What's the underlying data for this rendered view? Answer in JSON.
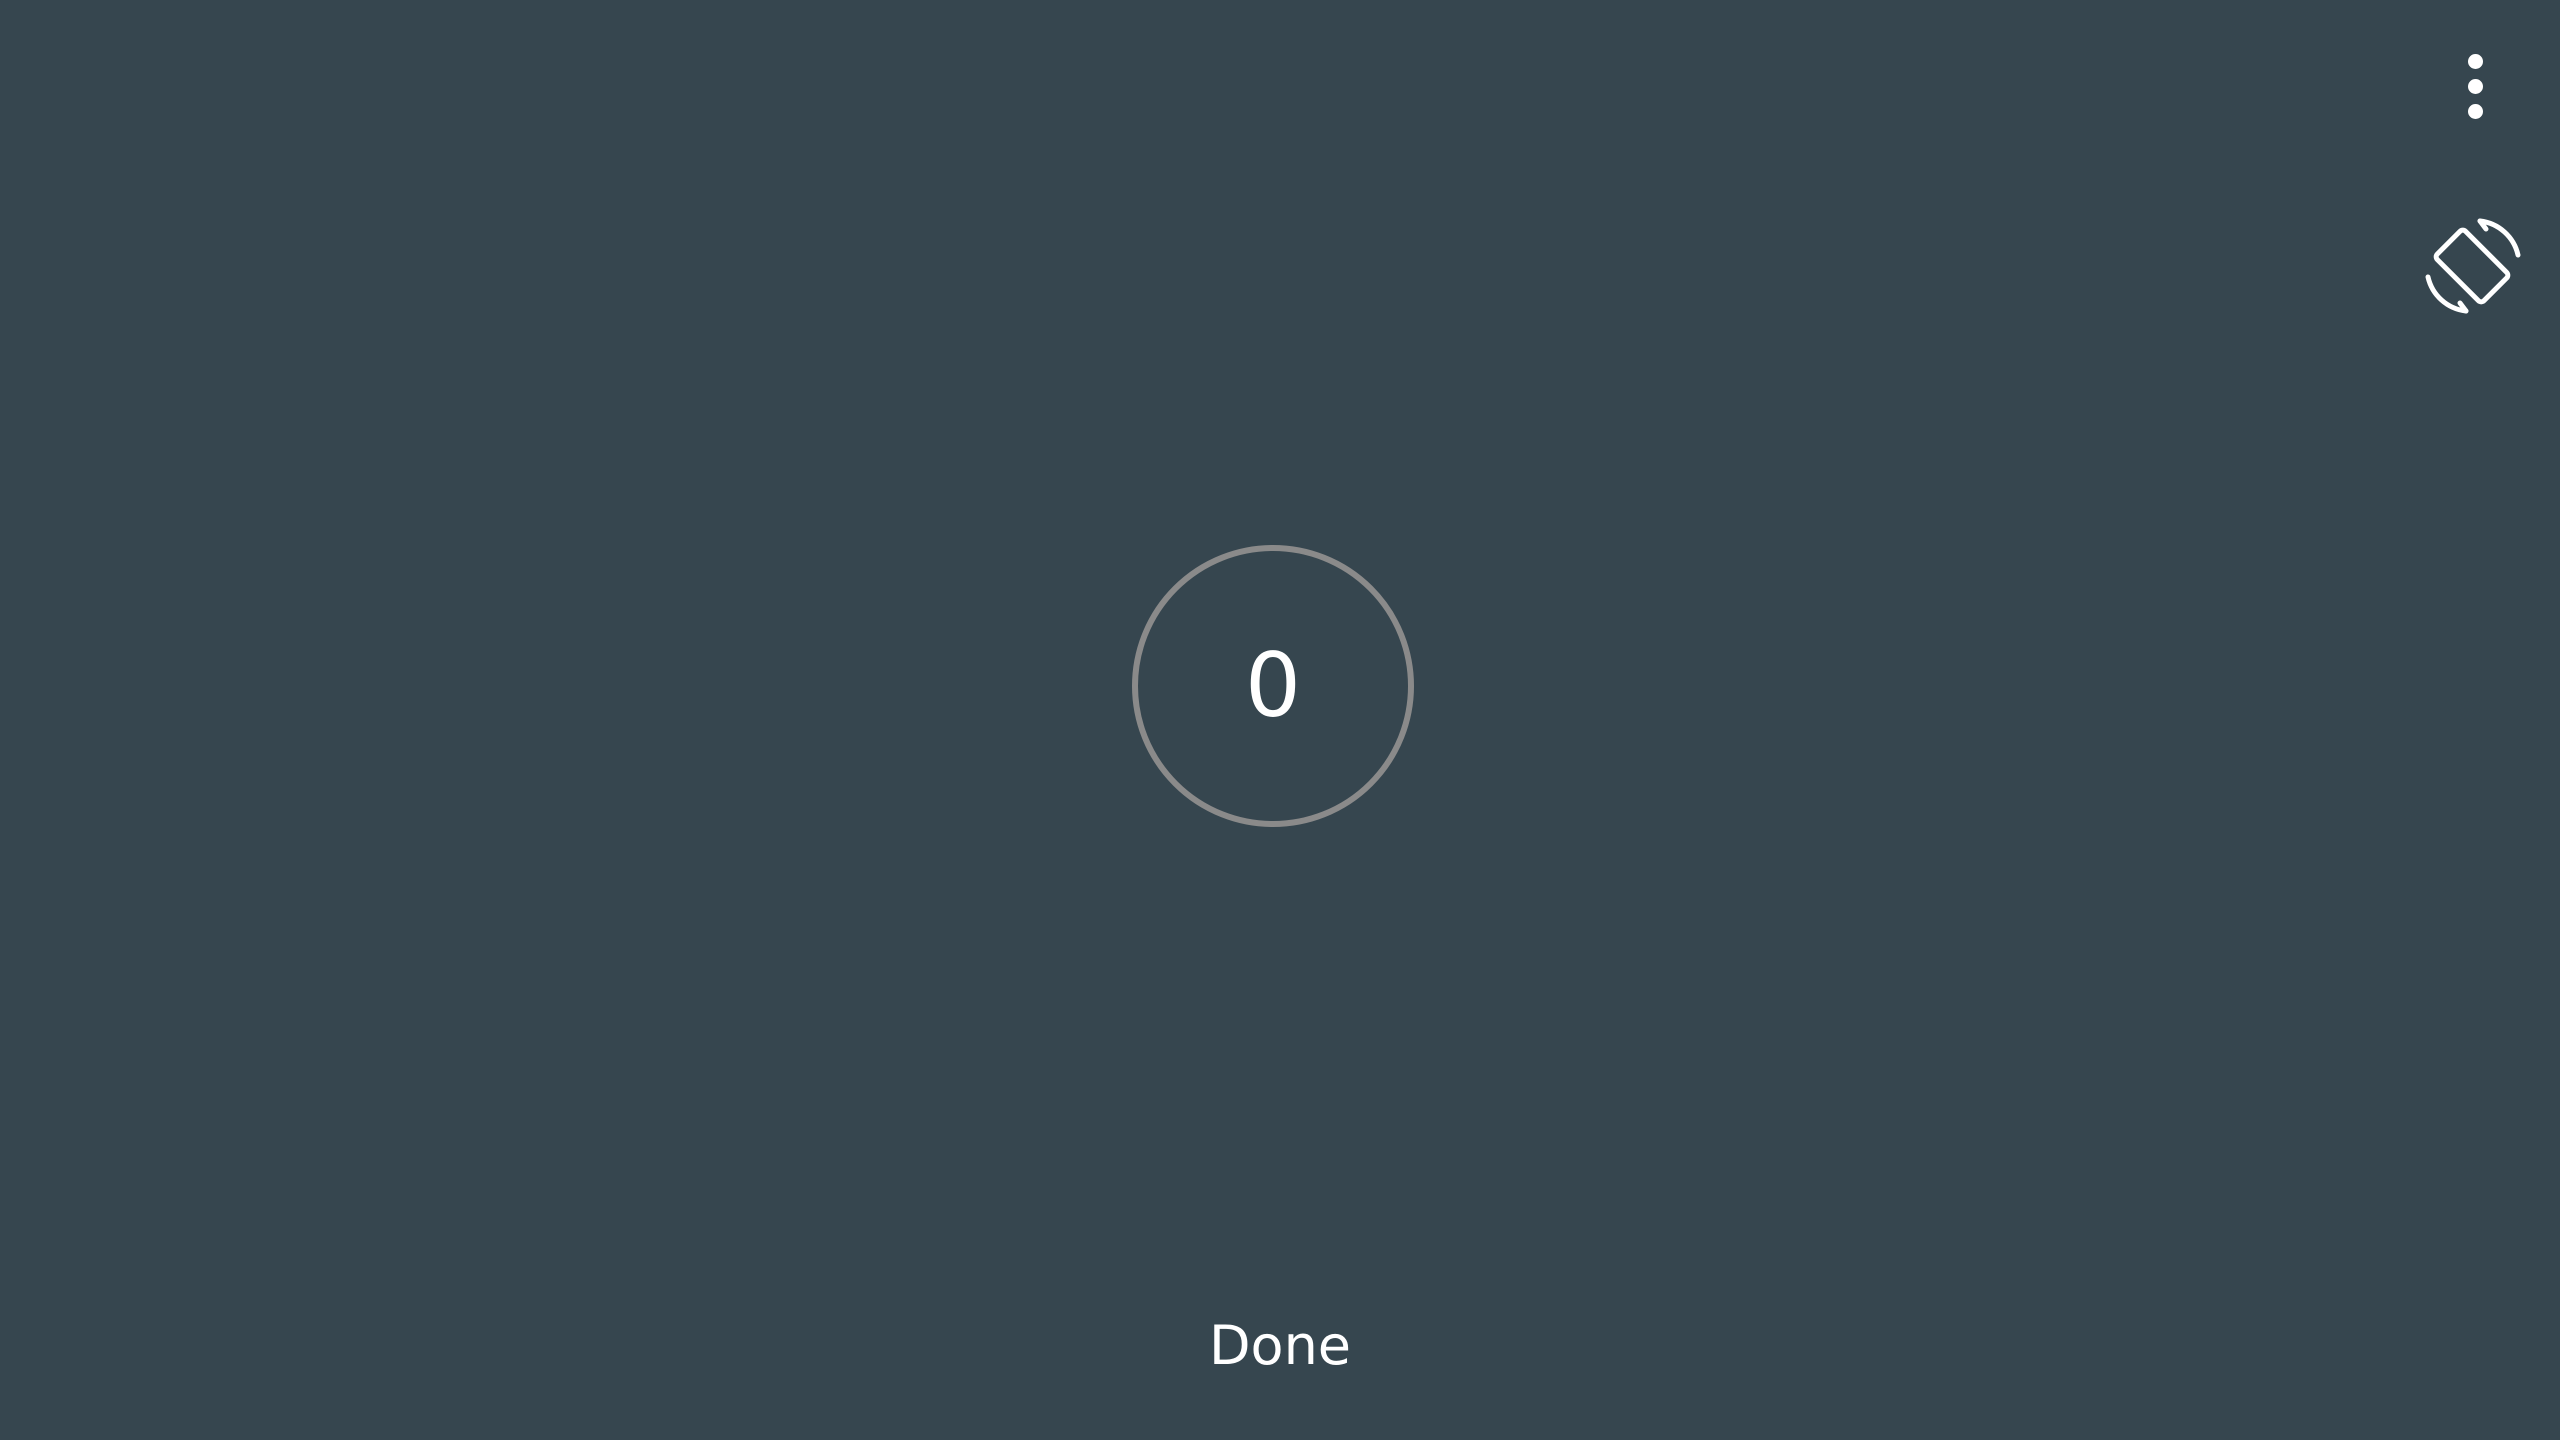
{
  "toolbar": {
    "overflow_icon": "more-vert-icon",
    "rotate_icon": "screen-rotation-icon"
  },
  "counter": {
    "value": "0",
    "ring_color": "#8a8a8a"
  },
  "footer": {
    "done_label": "Done"
  },
  "colors": {
    "background": "#36464f",
    "foreground": "#ffffff"
  }
}
